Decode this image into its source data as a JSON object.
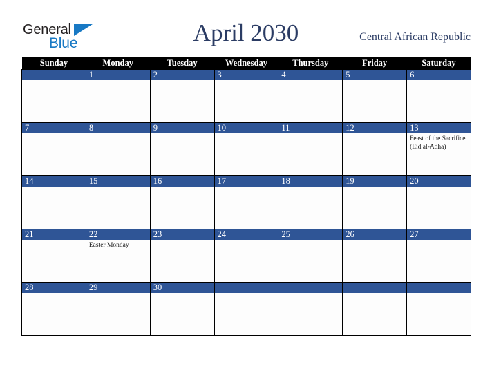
{
  "brand": {
    "name_part1": "General",
    "name_part2": "Blue",
    "color_dark": "#231f20",
    "color_blue": "#1879c4"
  },
  "header": {
    "title": "April 2030",
    "country": "Central African Republic",
    "title_color": "#2b3c64"
  },
  "calendar": {
    "accent_color": "#2f5596",
    "header_bg": "#000000",
    "weekdays": [
      "Sunday",
      "Monday",
      "Tuesday",
      "Wednesday",
      "Thursday",
      "Friday",
      "Saturday"
    ],
    "weeks": [
      [
        {
          "day": "",
          "events": []
        },
        {
          "day": "1",
          "events": []
        },
        {
          "day": "2",
          "events": []
        },
        {
          "day": "3",
          "events": []
        },
        {
          "day": "4",
          "events": []
        },
        {
          "day": "5",
          "events": []
        },
        {
          "day": "6",
          "events": []
        }
      ],
      [
        {
          "day": "7",
          "events": []
        },
        {
          "day": "8",
          "events": []
        },
        {
          "day": "9",
          "events": []
        },
        {
          "day": "10",
          "events": []
        },
        {
          "day": "11",
          "events": []
        },
        {
          "day": "12",
          "events": []
        },
        {
          "day": "13",
          "events": [
            "Feast of the Sacrifice (Eid al-Adha)"
          ]
        }
      ],
      [
        {
          "day": "14",
          "events": []
        },
        {
          "day": "15",
          "events": []
        },
        {
          "day": "16",
          "events": []
        },
        {
          "day": "17",
          "events": []
        },
        {
          "day": "18",
          "events": []
        },
        {
          "day": "19",
          "events": []
        },
        {
          "day": "20",
          "events": []
        }
      ],
      [
        {
          "day": "21",
          "events": []
        },
        {
          "day": "22",
          "events": [
            "Easter Monday"
          ]
        },
        {
          "day": "23",
          "events": []
        },
        {
          "day": "24",
          "events": []
        },
        {
          "day": "25",
          "events": []
        },
        {
          "day": "26",
          "events": []
        },
        {
          "day": "27",
          "events": []
        }
      ],
      [
        {
          "day": "28",
          "events": []
        },
        {
          "day": "29",
          "events": []
        },
        {
          "day": "30",
          "events": []
        },
        {
          "day": "",
          "events": []
        },
        {
          "day": "",
          "events": []
        },
        {
          "day": "",
          "events": []
        },
        {
          "day": "",
          "events": []
        }
      ]
    ]
  }
}
